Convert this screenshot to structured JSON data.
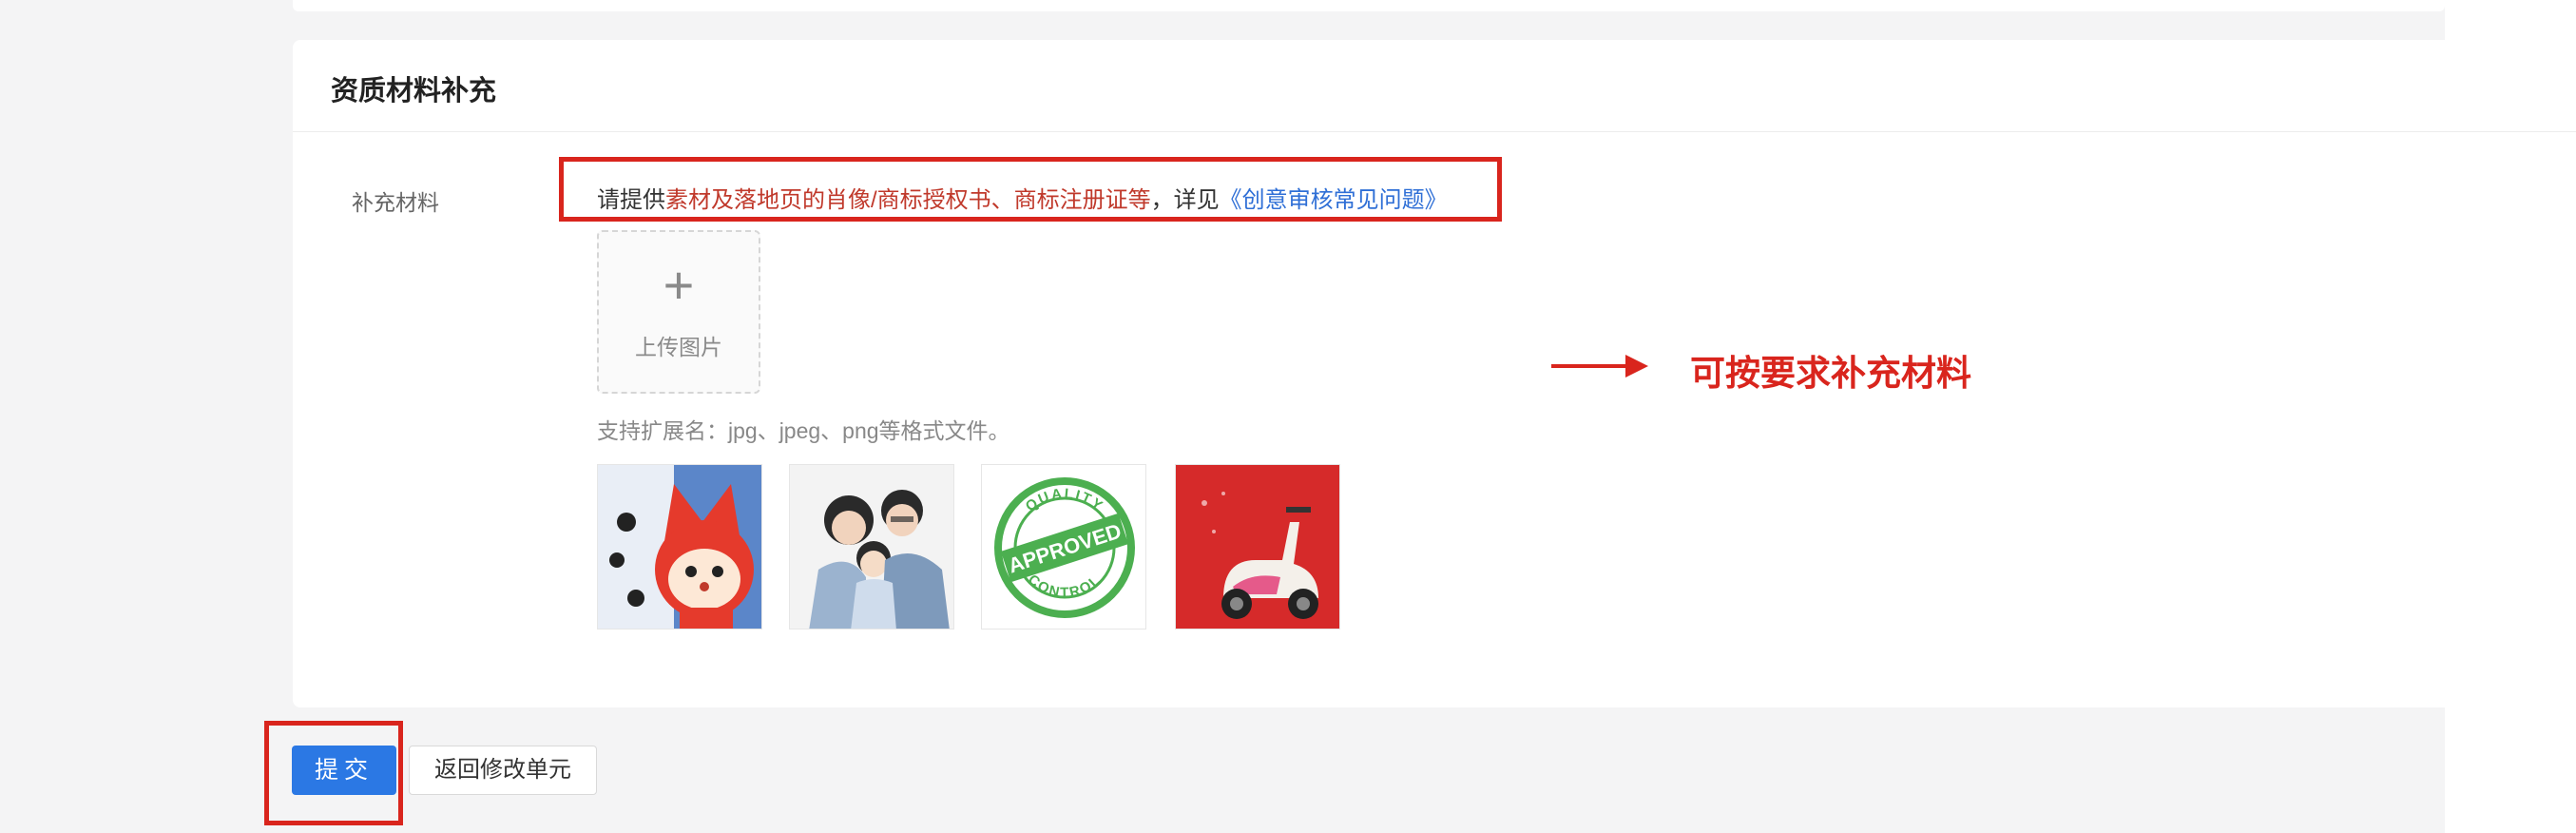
{
  "section": {
    "title": "资质材料补充"
  },
  "field": {
    "label": "补充材料"
  },
  "hint": {
    "prefix": "请提供",
    "highlight": "素材及落地页的肖像/商标授权书、商标注册证等",
    "middle": "，详见",
    "link": "《创意审核常见问题》"
  },
  "upload": {
    "plus": "+",
    "label": "上传图片"
  },
  "formats_text": "支持扩展名：jpg、jpeg、png等格式文件。",
  "annotation": {
    "text": "可按要求补充材料",
    "color": "#d9251d"
  },
  "buttons": {
    "submit": "提交",
    "back": "返回修改单元"
  },
  "thumbnails": [
    {
      "name": "cartoon-fox-image"
    },
    {
      "name": "family-photo-image"
    },
    {
      "name": "quality-approved-stamp-image",
      "ring_top": "QUALITY",
      "band": "APPROVED",
      "ring_bottom": "CONTROL"
    },
    {
      "name": "scooter-photo-image"
    }
  ],
  "colors": {
    "accent": "#2b78e4",
    "highlight_red": "#d9251d",
    "link_blue": "#2f6fd6"
  }
}
